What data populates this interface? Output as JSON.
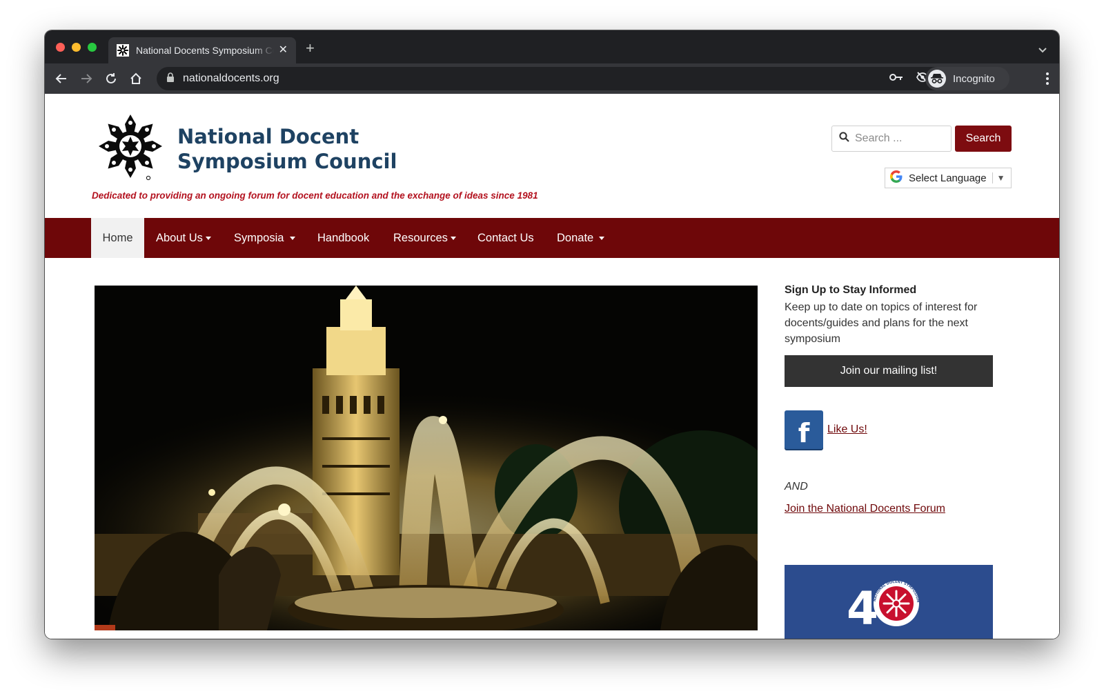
{
  "browser": {
    "tab_title": "National Docents Symposium Council",
    "new_tab_label": "+",
    "url": "nationaldocents.org",
    "profile_label": "Incognito"
  },
  "header": {
    "site_name_line1": "National Docent",
    "site_name_line2": "Symposium Council",
    "tagline": "Dedicated to providing an ongoing forum for docent education and the exchange of ideas since 1981"
  },
  "search": {
    "placeholder": "Search ...",
    "button_label": "Search"
  },
  "language": {
    "label": "Select Language"
  },
  "nav": {
    "items": [
      {
        "label": "Home",
        "active": true
      },
      {
        "label": "About Us",
        "dropdown": true
      },
      {
        "label": "Symposia",
        "dropdown": true
      },
      {
        "label": "Handbook"
      },
      {
        "label": "Resources",
        "dropdown": true
      },
      {
        "label": "Contact Us"
      },
      {
        "label": "Donate",
        "dropdown": true
      }
    ]
  },
  "sidebar": {
    "signup_title": "Sign Up to Stay Informed",
    "signup_text": "Keep up to date on topics of interest for docents/guides and plans for the next symposium",
    "mailing_button": "Join our mailing list!",
    "facebook_letter": "f",
    "facebook_link": "Like Us!",
    "and_text": "AND",
    "forum_link": "Join the National Docents Forum",
    "badge_number": "4",
    "badge_ring_text": "NATIONAL DOCENT SYMPOSIUM COUNCIL"
  },
  "colors": {
    "brand_navy": "#1e4262",
    "brand_red": "#6e0709",
    "tagline_red": "#b3121f",
    "search_button": "#7d0c10",
    "mailing_button": "#333333",
    "facebook_blue": "#2a5b9a"
  },
  "icons": {
    "tab_favicon": "snowflake-icon",
    "lock": "lock-icon",
    "key": "key-icon",
    "eye_off": "eye-off-icon",
    "star": "star-icon",
    "search": "search-icon",
    "google": "google-g-icon"
  }
}
